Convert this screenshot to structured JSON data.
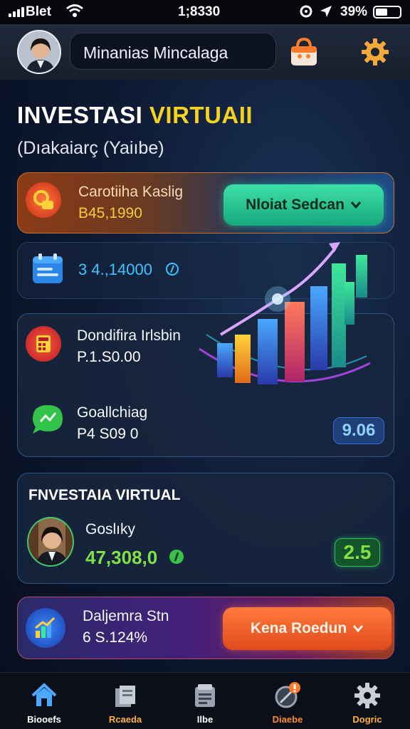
{
  "status": {
    "carrier": "Blet",
    "time": "1;8330",
    "battery": "39%"
  },
  "header": {
    "user_name": "Minanias Mincalaga",
    "icons": [
      "avatar-photo",
      "shopping-bag-icon",
      "gear-icon"
    ]
  },
  "page": {
    "title_part1": "INVESTASI ",
    "title_part2": "VIRTUAII",
    "subtitle": "(Dıakaiarç (Yaiıbe)"
  },
  "card1": {
    "label": "Carotiiha Kaslig",
    "value": "B45,1990",
    "button_label": "Nloiat Sedcan"
  },
  "card2": {
    "value": "3 4.,14000"
  },
  "card3": {
    "item1_label": "Dondifira Irlsbin",
    "item1_value": "P.1.S0.00",
    "item2_label": "Goallchiag",
    "item2_value": "P4 S09 0",
    "badge": "9.06"
  },
  "card4": {
    "heading": "FNVESTAIA VIRTUAL",
    "label": "Goslıky",
    "value": "47,308,0",
    "badge": "2.5"
  },
  "card5": {
    "label": "Daljemra Stn",
    "value": "6 S.124%",
    "button_label": "Kena Roedun"
  },
  "nav": {
    "items": [
      {
        "label": "Biooefs",
        "icon": "home-icon",
        "color": "#ffffff"
      },
      {
        "label": "Rcaeda",
        "icon": "archive-icon",
        "color": "#ffb23a"
      },
      {
        "label": "Ilbe",
        "icon": "document-icon",
        "color": "#ffffff"
      },
      {
        "label": "Diaebe",
        "icon": "compass-icon",
        "color": "#ff8a2a"
      },
      {
        "label": "Dogric",
        "icon": "settings-icon",
        "color": "#ffb23a"
      }
    ]
  },
  "colors": {
    "accent_yellow": "#f6d21e",
    "accent_green": "#2fd69a",
    "accent_orange": "#ff6a2b",
    "value_gold": "#f2cc3a",
    "value_cyan": "#39c6ff"
  }
}
